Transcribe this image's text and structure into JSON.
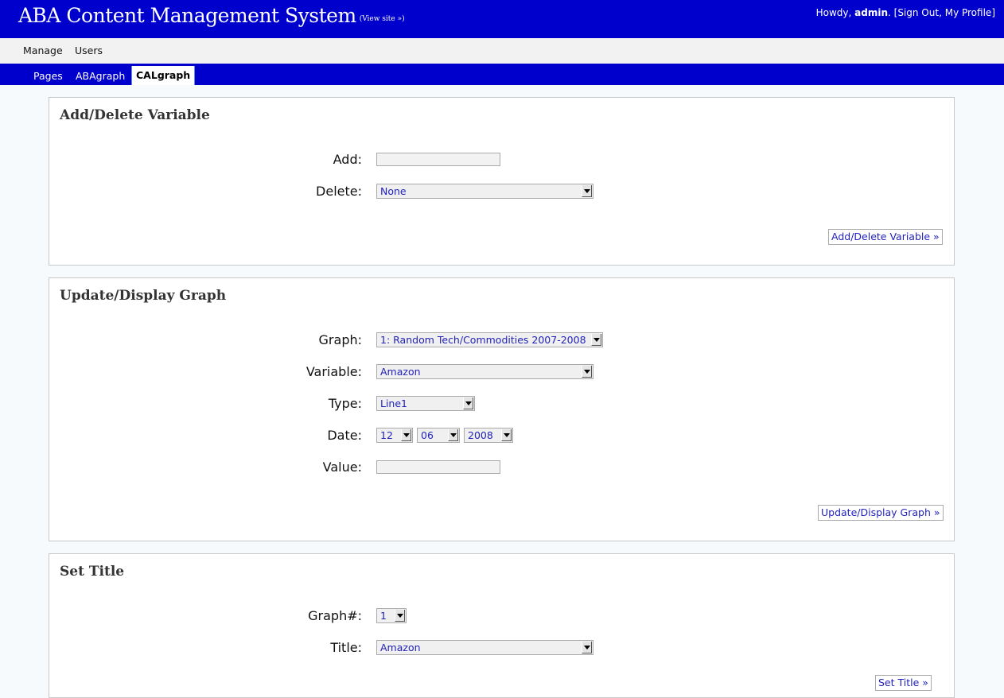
{
  "header": {
    "site_title": "ABA Content Management System",
    "view_site": "(View site »)",
    "howdy": "Howdy,",
    "username": "admin",
    "sep_open": ". [",
    "sign_out": "Sign Out",
    "comma": ",",
    "my_profile": "My Profile",
    "sep_close": "]",
    "brand_color": "#0000cc"
  },
  "menu": {
    "items": [
      {
        "label": "Manage"
      },
      {
        "label": "Users"
      }
    ]
  },
  "tabs": {
    "items": [
      {
        "label": "Pages"
      },
      {
        "label": "ABAgraph"
      },
      {
        "label": "CALgraph",
        "active": true
      }
    ]
  },
  "add_delete": {
    "title": "Add/Delete Variable",
    "add_label": "Add:",
    "add_value": "",
    "delete_label": "Delete:",
    "delete_value": "None",
    "button": "Add/Delete Variable »"
  },
  "update_graph": {
    "title": "Update/Display Graph",
    "graph_label": "Graph:",
    "graph_value": "1: Random Tech/Commodities 2007-2008",
    "variable_label": "Variable:",
    "variable_value": "Amazon",
    "type_label": "Type:",
    "type_value": "Line1",
    "date_label": "Date:",
    "date_month": "12",
    "date_day": "06",
    "date_year": "2008",
    "value_label": "Value:",
    "value_value": "",
    "button": "Update/Display Graph »"
  },
  "set_title": {
    "title": "Set Title",
    "graph_num_label": "Graph#:",
    "graph_num_value": "1",
    "title_label": "Title:",
    "title_value": "Amazon",
    "button": "Set Title »"
  }
}
